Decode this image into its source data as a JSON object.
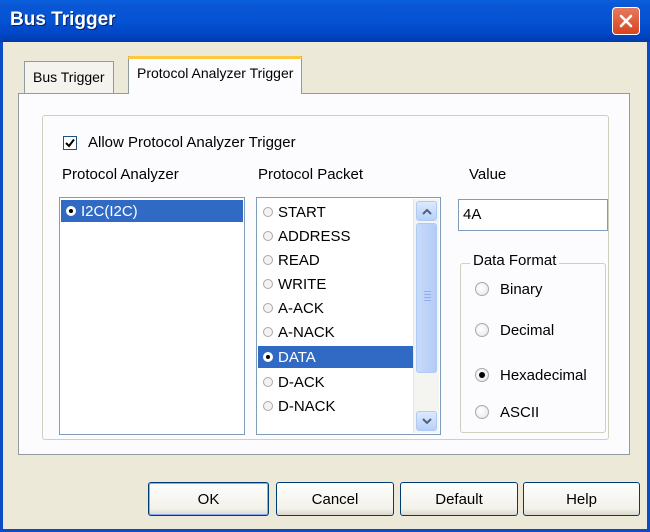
{
  "window": {
    "title": "Bus Trigger"
  },
  "tabs": [
    {
      "label": "Bus Trigger",
      "active": false
    },
    {
      "label": "Protocol Analyzer Trigger",
      "active": true
    }
  ],
  "allow_trigger": {
    "label": "Allow Protocol Analyzer Trigger",
    "checked": true
  },
  "protocol_analyzer": {
    "header": "Protocol Analyzer",
    "items": [
      {
        "label": "I2C(I2C)",
        "selected": true
      }
    ]
  },
  "protocol_packet": {
    "header": "Protocol Packet",
    "items": [
      {
        "label": "START",
        "selected": false
      },
      {
        "label": "ADDRESS",
        "selected": false
      },
      {
        "label": "READ",
        "selected": false
      },
      {
        "label": "WRITE",
        "selected": false
      },
      {
        "label": "A-ACK",
        "selected": false
      },
      {
        "label": "A-NACK",
        "selected": false
      },
      {
        "label": "DATA",
        "selected": true
      },
      {
        "label": "D-ACK",
        "selected": false
      },
      {
        "label": "D-NACK",
        "selected": false
      }
    ]
  },
  "value": {
    "header": "Value",
    "text": "4A"
  },
  "data_format": {
    "legend": "Data Format",
    "options": [
      {
        "label": "Binary",
        "selected": false
      },
      {
        "label": "Decimal",
        "selected": false
      },
      {
        "label": "Hexadecimal",
        "selected": true
      },
      {
        "label": "ASCII",
        "selected": false
      }
    ]
  },
  "buttons": {
    "ok": "OK",
    "cancel": "Cancel",
    "default": "Default",
    "help": "Help"
  },
  "colors": {
    "titlebar": "#0453d4",
    "selection": "#316ac5",
    "close": "#d8441e",
    "tab_highlight": "#ffc73c"
  },
  "icons": [
    "close-icon",
    "checkmark-icon",
    "scroll-up-icon",
    "scroll-down-icon"
  ]
}
